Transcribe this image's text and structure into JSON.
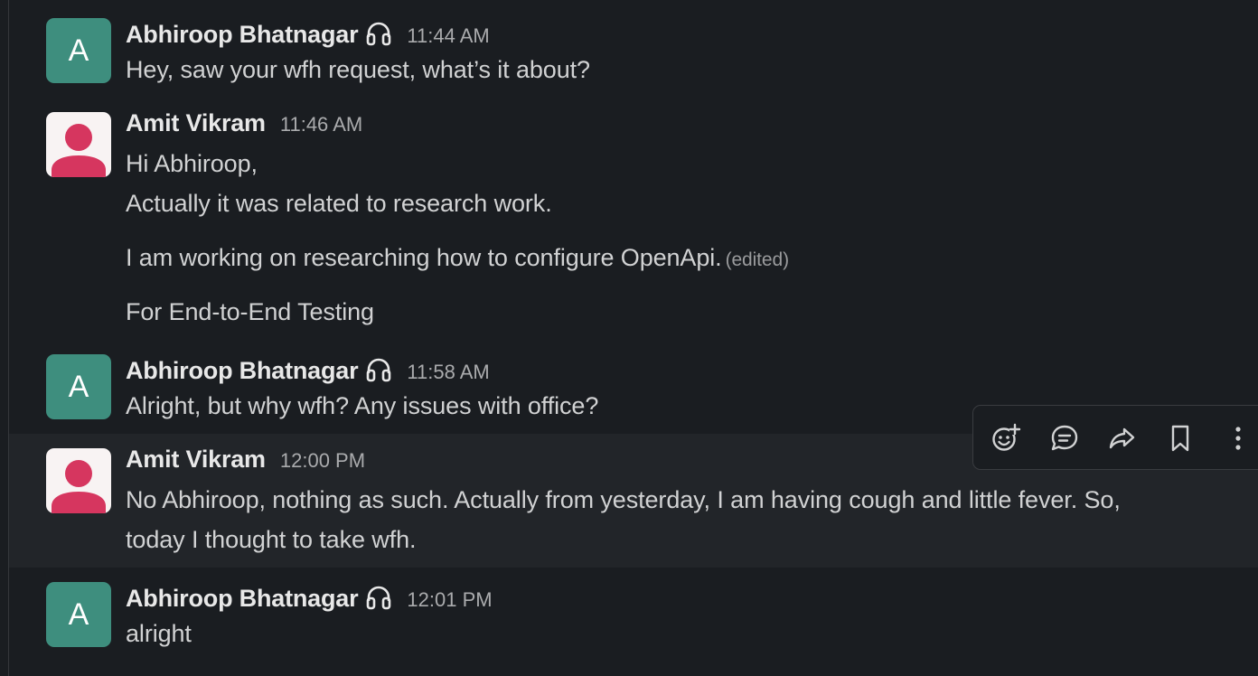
{
  "messages": [
    {
      "author": "Abhiroop Bhatnagar",
      "avatar_letter": "A",
      "status_icon": "headphones-icon",
      "time": "11:44 AM",
      "lines": [
        "Hey, saw your wfh request, what’s it about?"
      ]
    },
    {
      "author": "Amit Vikram",
      "avatar_icon": "default-user-avatar",
      "time": "11:46 AM",
      "lines": [
        "Hi Abhiroop,",
        "Actually it was related to research work.",
        "I am working on researching how to configure OpenApi.",
        "For End-to-End Testing"
      ],
      "edited_label": "(edited)"
    },
    {
      "author": "Abhiroop Bhatnagar",
      "avatar_letter": "A",
      "status_icon": "headphones-icon",
      "time": "11:58 AM",
      "lines": [
        "Alright, but why wfh? Any issues with office?"
      ]
    },
    {
      "author": "Amit Vikram",
      "avatar_icon": "default-user-avatar",
      "time": "12:00 PM",
      "lines": [
        "No Abhiroop, nothing as such. Actually from yesterday,  I am having cough and little fever. So,",
        "today I thought to take wfh."
      ]
    },
    {
      "author": "Abhiroop Bhatnagar",
      "avatar_letter": "A",
      "status_icon": "headphones-icon",
      "time": "12:01 PM",
      "lines": [
        "alright"
      ]
    }
  ],
  "hover_toolbar": {
    "buttons": [
      "add-reaction-icon",
      "reply-in-thread-icon",
      "forward-message-icon",
      "save-bookmark-icon",
      "more-actions-icon"
    ]
  },
  "colors": {
    "background": "#1a1d21",
    "hover_background": "#222529",
    "avatar_letter_bg": "#3e8e7e",
    "avatar_person_fg": "#d6365f",
    "text": "#d1d2d3",
    "timestamp": "#aaabad"
  }
}
